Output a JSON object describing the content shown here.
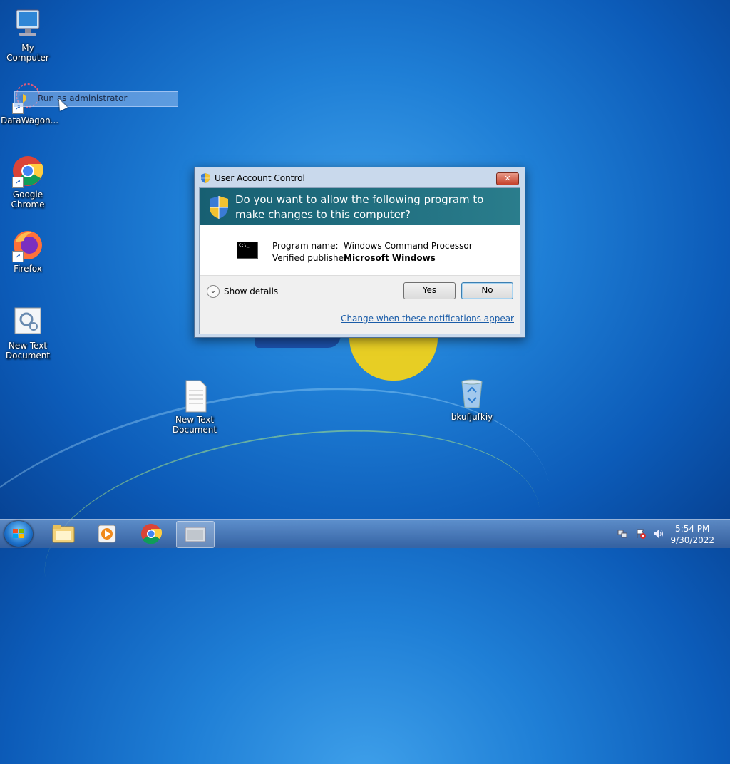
{
  "desktop": {
    "icons": [
      {
        "label": "My Computer"
      },
      {
        "label": "DataWagon..."
      },
      {
        "label": "Google Chrome"
      },
      {
        "label": "Firefox"
      },
      {
        "label": "New Text Document"
      },
      {
        "label": "New Text Document"
      },
      {
        "label": "bkufjufkiy"
      }
    ],
    "context_tooltip": "Run as administrator"
  },
  "uac": {
    "title": "User Account Control",
    "close_label": "✕",
    "question": "Do you want to allow the following program to make changes to this computer?",
    "program_name_label": "Program name:",
    "program_name": "Windows Command Processor",
    "publisher_label": "Verified publisher:",
    "publisher": "Microsoft Windows",
    "show_details": "Show details",
    "yes_label": "Yes",
    "no_label": "No",
    "change_link": "Change when these notifications appear",
    "cmd_icon_text": "C:\\_"
  },
  "taskbar": {
    "time": "5:54 PM",
    "date": "9/30/2022",
    "items": [
      "start-button",
      "file-explorer",
      "media-player",
      "google-chrome",
      "cmd-window"
    ]
  },
  "colors": {
    "banner": "#1e6a7a",
    "link": "#1a5ca8",
    "desktop": "#1f7fd6"
  }
}
